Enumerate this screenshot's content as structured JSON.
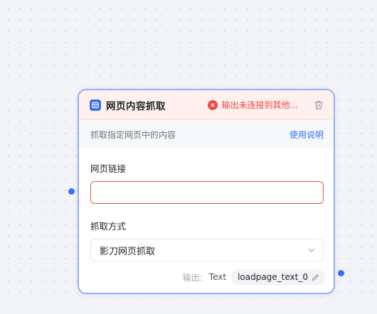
{
  "node": {
    "title": "网页内容抓取",
    "icon": "browser-icon",
    "error_text": "输出未连接到其他...",
    "description": "抓取指定网页中的内容",
    "doc_link": "使用说明",
    "url_field": {
      "label": "网页链接",
      "value": "",
      "placeholder": ""
    },
    "method_field": {
      "label": "抓取方式",
      "value": "影刀网页抓取"
    },
    "output": {
      "label": "输出:",
      "type": "Text",
      "variable": "loadpage_text_0"
    }
  },
  "colors": {
    "accent": "#3370ff",
    "error": "#f04a3f",
    "node_border": "#8fb0f5",
    "header_bg": "#fdf0ef"
  }
}
